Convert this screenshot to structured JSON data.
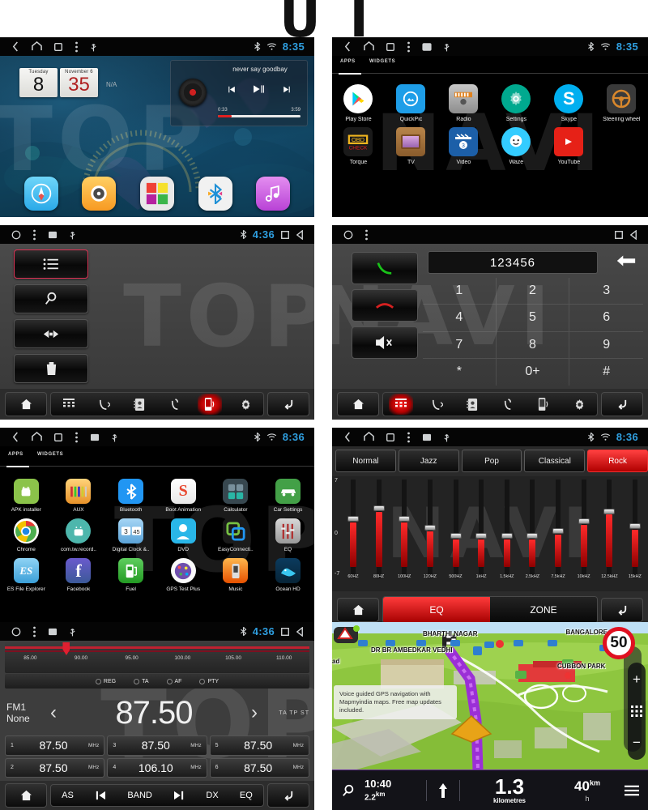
{
  "header": {
    "letters": [
      "U",
      "I"
    ]
  },
  "watermark": {
    "left": "TOP",
    "right": "NAVI"
  },
  "panels": {
    "home": {
      "name": "Home screen",
      "statusbar": {
        "icons": [
          "back-icon",
          "home-icon",
          "recents-icon",
          "menu-icon",
          "usb-icon"
        ],
        "right_icons": [
          "bluetooth-icon",
          "wifi-icon"
        ],
        "time": "8:35"
      },
      "widget_datetime": {
        "weekday_label": "Tuesday",
        "weekday_value": "8",
        "month_label": "November 6",
        "month_value": "35",
        "weather": "N/A"
      },
      "widget_music": {
        "title": "never say goodbay",
        "elapsed": "0:33",
        "duration": "3:59",
        "progress_percent": 17,
        "controls": [
          "previous-icon",
          "play-pause-icon",
          "next-icon"
        ]
      },
      "dock": [
        {
          "name": "navigation",
          "icon": "compass-icon"
        },
        {
          "name": "dvd",
          "icon": "disc-icon"
        },
        {
          "name": "apps",
          "icon": "grid-icon"
        },
        {
          "name": "bluetooth",
          "icon": "bluetooth-icon"
        },
        {
          "name": "music",
          "icon": "music-note-icon"
        }
      ]
    },
    "app_drawer": {
      "name": "App drawer",
      "statusbar": {
        "icons": [
          "back-icon",
          "home-icon",
          "recents-icon",
          "menu-icon",
          "screenshot-icon",
          "usb-icon"
        ],
        "right_icons": [
          "bluetooth-icon",
          "wifi-icon"
        ],
        "time": "8:35"
      },
      "tabs": [
        {
          "label": "APPS",
          "selected": true
        },
        {
          "label": "WIDGETS",
          "selected": false
        }
      ],
      "apps": [
        {
          "label": "Play Store",
          "icon": "play-store-icon"
        },
        {
          "label": "QuickPic",
          "icon": "quickpic-icon"
        },
        {
          "label": "Radio",
          "icon": "radio-icon"
        },
        {
          "label": "Settings",
          "icon": "gear-icon"
        },
        {
          "label": "Skype",
          "icon": "skype-icon"
        },
        {
          "label": "Steering wheel",
          "icon": "steering-wheel-icon"
        },
        {
          "label": "Torque",
          "icon": "torque-obd-icon"
        },
        {
          "label": "TV",
          "icon": "tv-icon"
        },
        {
          "label": "Video",
          "icon": "video-clapper-icon"
        },
        {
          "label": "Waze",
          "icon": "waze-icon"
        },
        {
          "label": "YouTube",
          "icon": "youtube-icon"
        }
      ]
    },
    "bt_music": {
      "name": "Bluetooth music browser",
      "statusbar": {
        "icons": [
          "home-circle-icon",
          "menu-icon",
          "screenshot-icon",
          "usb-icon"
        ],
        "right_icons": [
          "bluetooth-icon"
        ],
        "time": "4:36",
        "right_nav": [
          "square-icon",
          "back-triangle-icon"
        ]
      },
      "buttons": [
        {
          "icon": "list-icon",
          "selected": true
        },
        {
          "icon": "search-icon",
          "selected": false
        },
        {
          "icon": "transfer-icon",
          "selected": false
        },
        {
          "icon": "trash-icon",
          "selected": false
        }
      ],
      "toolbar": [
        {
          "icon": "home-icon",
          "selected": false
        },
        {
          "icon": "dialpad-icon",
          "selected": false
        },
        {
          "icon": "incoming-call-icon",
          "selected": false
        },
        {
          "icon": "contacts-icon",
          "selected": false
        },
        {
          "icon": "call-history-icon",
          "selected": false
        },
        {
          "icon": "phone-sync-icon",
          "selected": true
        },
        {
          "icon": "gear-icon",
          "selected": false
        },
        {
          "icon": "back-arrow-icon",
          "selected": false
        }
      ]
    },
    "dialer": {
      "name": "Bluetooth dialer",
      "statusbar": {
        "icons": [
          "home-circle-icon",
          "menu-icon"
        ],
        "time": "",
        "right_nav": [
          "square-icon",
          "back-triangle-icon"
        ]
      },
      "number": "123456",
      "backspace_icon": "backspace-arrow-icon",
      "side_buttons": [
        {
          "icon": "answer-call-icon"
        },
        {
          "icon": "end-call-icon"
        },
        {
          "icon": "mute-speaker-icon"
        }
      ],
      "keys": [
        "1",
        "2",
        "3",
        "4",
        "5",
        "6",
        "7",
        "8",
        "9",
        "*",
        "0+",
        "#"
      ],
      "toolbar": [
        {
          "icon": "home-icon",
          "selected": false
        },
        {
          "icon": "dialpad-icon",
          "selected": true
        },
        {
          "icon": "incoming-call-icon",
          "selected": false
        },
        {
          "icon": "contacts-icon",
          "selected": false
        },
        {
          "icon": "call-history-icon",
          "selected": false
        },
        {
          "icon": "phone-sync-icon",
          "selected": false
        },
        {
          "icon": "gear-icon",
          "selected": false
        },
        {
          "icon": "back-arrow-icon",
          "selected": false
        }
      ]
    },
    "apps_list": {
      "name": "All applications",
      "statusbar": {
        "icons": [
          "back-icon",
          "home-icon",
          "recents-icon",
          "menu-icon",
          "screenshot-icon",
          "usb-icon"
        ],
        "right_icons": [
          "bluetooth-icon",
          "wifi-icon"
        ],
        "time": "8:36"
      },
      "tabs": [
        {
          "label": "APPS",
          "selected": true
        },
        {
          "label": "WIDGETS",
          "selected": false
        }
      ],
      "apps": [
        {
          "label": "APK installer",
          "icon": "android-icon"
        },
        {
          "label": "AUX",
          "icon": "aux-icon"
        },
        {
          "label": "Bluetooth",
          "icon": "bluetooth-icon"
        },
        {
          "label": "Boot Animation",
          "icon": "boot-animation-icon"
        },
        {
          "label": "Calculator",
          "icon": "calculator-icon"
        },
        {
          "label": "Car Settings",
          "icon": "car-settings-icon"
        },
        {
          "label": "Chrome",
          "icon": "chrome-icon"
        },
        {
          "label": "com.tw.record..",
          "icon": "android-record-icon"
        },
        {
          "label": "Digital Clock &..",
          "icon": "digital-clock-icon"
        },
        {
          "label": "DVD",
          "icon": "dvd-icon"
        },
        {
          "label": "EasyConnecti..",
          "icon": "easyconnection-icon"
        },
        {
          "label": "EQ",
          "icon": "equalizer-icon"
        },
        {
          "label": "ES File Explorer",
          "icon": "es-file-explorer-icon"
        },
        {
          "label": "Facebook",
          "icon": "facebook-icon"
        },
        {
          "label": "Fuel",
          "icon": "fuel-pump-icon"
        },
        {
          "label": "GPS Test Plus",
          "icon": "gps-test-icon"
        },
        {
          "label": "Music",
          "icon": "music-icon"
        },
        {
          "label": "Ocean HD",
          "icon": "ocean-hd-icon"
        }
      ]
    },
    "equalizer": {
      "name": "Equalizer",
      "statusbar": {
        "icons": [
          "back-icon",
          "home-icon",
          "recents-icon",
          "menu-icon",
          "screenshot-icon",
          "usb-icon"
        ],
        "right_icons": [
          "bluetooth-icon",
          "wifi-icon"
        ],
        "time": "8:36"
      },
      "presets": [
        {
          "label": "Normal",
          "selected": false
        },
        {
          "label": "Jazz",
          "selected": false
        },
        {
          "label": "Pop",
          "selected": false
        },
        {
          "label": "Classical",
          "selected": false
        },
        {
          "label": "Rock",
          "selected": true
        }
      ],
      "scale": {
        "top": "7",
        "mid": "0",
        "bottom": "-7"
      },
      "bands": [
        {
          "freq": "60HZ",
          "value": 4
        },
        {
          "freq": "80HZ",
          "value": 6
        },
        {
          "freq": "100HZ",
          "value": 4
        },
        {
          "freq": "120HZ",
          "value": 2
        },
        {
          "freq": "500HZ",
          "value": 0
        },
        {
          "freq": "1kHZ",
          "value": 0
        },
        {
          "freq": "1.5kHZ",
          "value": 0
        },
        {
          "freq": "2.5kHZ",
          "value": 0
        },
        {
          "freq": "7.5kHZ",
          "value": 1
        },
        {
          "freq": "10kHZ",
          "value": 3
        },
        {
          "freq": "12.5kHZ",
          "value": 5
        },
        {
          "freq": "15kHZ",
          "value": 2
        }
      ],
      "bottom": {
        "home_icon": "home-icon",
        "eq_label": "EQ",
        "zone_label": "ZONE",
        "back_icon": "back-arrow-icon"
      }
    },
    "radio": {
      "name": "FM radio",
      "statusbar": {
        "icons": [
          "home-circle-icon",
          "menu-icon",
          "screenshot-icon",
          "usb-icon"
        ],
        "right_icons": [
          "bluetooth-icon"
        ],
        "time": "4:36",
        "right_nav": [
          "square-icon",
          "back-triangle-icon"
        ]
      },
      "scale_ticks": [
        "85.00",
        "90.00",
        "95.00",
        "100.00",
        "105.00",
        "110.00"
      ],
      "pointer_percent": 19,
      "rds": [
        "REG",
        "TA",
        "AF",
        "PTY"
      ],
      "band": "FM1",
      "station_name": "None",
      "frequency": "87.50",
      "indicators": "TA TP ST",
      "presets": [
        {
          "num": "1",
          "freq": "87.50",
          "unit": "MHz"
        },
        {
          "num": "3",
          "freq": "87.50",
          "unit": "MHz"
        },
        {
          "num": "5",
          "freq": "87.50",
          "unit": "MHz"
        },
        {
          "num": "2",
          "freq": "87.50",
          "unit": "MHz"
        },
        {
          "num": "4",
          "freq": "106.10",
          "unit": "MHz"
        },
        {
          "num": "6",
          "freq": "87.50",
          "unit": "MHz"
        }
      ],
      "toolbar": {
        "home_icon": "home-icon",
        "items": [
          "AS",
          "prev-icon",
          "BAND",
          "next-icon",
          "DX",
          "EQ"
        ],
        "back_icon": "back-arrow-icon"
      }
    },
    "navigation": {
      "name": "GPS navigation",
      "map_labels": [
        {
          "text": "BHARTHI NAGAR"
        },
        {
          "text": "BANGALORE"
        },
        {
          "text": "DR BR AMBEDKAR VEDHI"
        },
        {
          "text": "CUBBON PARK"
        },
        {
          "text": "ad"
        }
      ],
      "speed_limit": "50",
      "tooltip": "Voice guided GPS navigation with Mapmyindia maps. Free map updates included.",
      "zoom_controls": [
        "plus-icon",
        "grid-icon",
        "minus-icon"
      ],
      "bottom_bar": {
        "search_icon": "search-icon",
        "eta_time": "10:40",
        "eta_distance": "2.2",
        "eta_distance_unit": "km",
        "direction_icon": "arrow-up-icon",
        "distance": "1.3",
        "distance_unit": "kilometres",
        "speed": "40",
        "speed_unit_top": "km",
        "speed_unit_bottom": "h",
        "menu_icon": "hamburger-icon"
      }
    }
  }
}
